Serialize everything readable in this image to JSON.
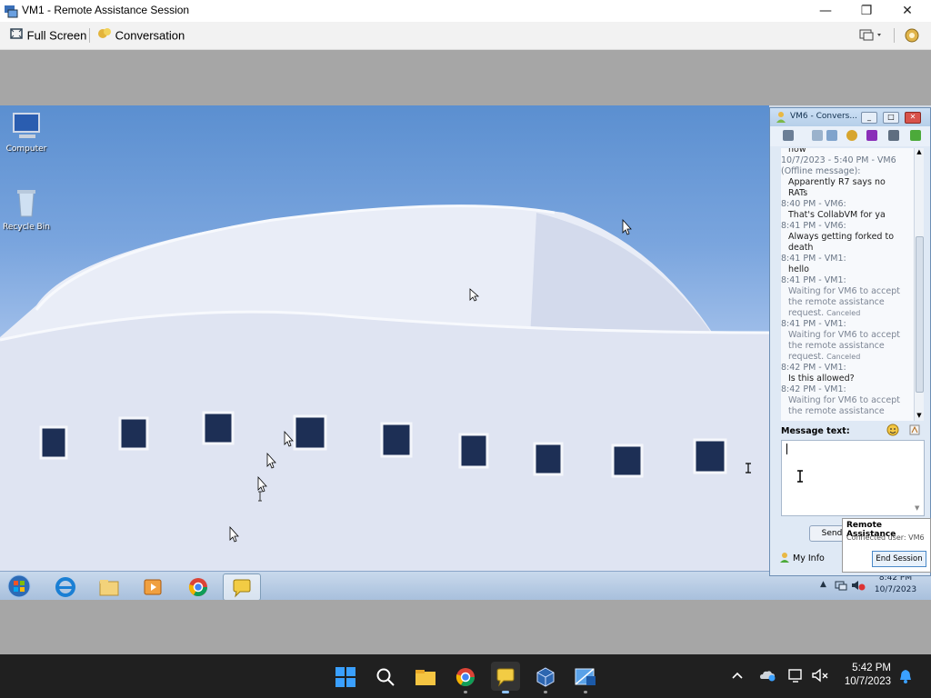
{
  "window": {
    "title": "VM1 - Remote Assistance Session",
    "minimize": "—",
    "restore": "❐",
    "close": "✕"
  },
  "toolbar": {
    "full_screen": "Full Screen",
    "conversation": "Conversation"
  },
  "desktop": {
    "icons": [
      {
        "label": "Computer"
      },
      {
        "label": "Recycle Bin"
      }
    ],
    "taskbar_clock": {
      "time": "8:42 PM",
      "date": "10/7/2023"
    }
  },
  "conversation": {
    "title": "VM6 - Convers...",
    "messages": [
      {
        "meta": "",
        "body": "now"
      },
      {
        "meta": "10/7/2023 - 5:40 PM - VM6",
        "body": ""
      },
      {
        "meta": "(Offline message):",
        "body": ""
      },
      {
        "meta": "",
        "body": "Apparently R7 says no"
      },
      {
        "meta": "",
        "body": "RATs"
      },
      {
        "meta": "8:40 PM - VM6:",
        "body": ""
      },
      {
        "meta": "",
        "body": "That's CollabVM for ya"
      },
      {
        "meta": "8:41 PM - VM6:",
        "body": ""
      },
      {
        "meta": "",
        "body": "Always getting forked to"
      },
      {
        "meta": "",
        "body": "death"
      },
      {
        "meta": "8:41 PM - VM1:",
        "body": ""
      },
      {
        "meta": "",
        "body": "hello"
      },
      {
        "meta": "8:41 PM - VM1:",
        "body": ""
      },
      {
        "meta": "",
        "grey": "Waiting for VM6 to accept"
      },
      {
        "meta": "",
        "grey": "the remote assistance"
      },
      {
        "meta": "",
        "grey": "request.",
        "small": "Canceled"
      },
      {
        "meta": "8:41 PM - VM1:",
        "body": ""
      },
      {
        "meta": "",
        "grey": "Waiting for VM6 to accept"
      },
      {
        "meta": "",
        "grey": "the remote assistance"
      },
      {
        "meta": "",
        "grey": "request.",
        "small": "Canceled"
      },
      {
        "meta": "8:42 PM - VM1:",
        "body": ""
      },
      {
        "meta": "",
        "body": "Is this allowed?"
      },
      {
        "meta": "8:42 PM - VM1:",
        "body": ""
      },
      {
        "meta": "",
        "grey": "Waiting for VM6 to accept"
      },
      {
        "meta": "",
        "grey": "the remote assistance"
      }
    ],
    "message_text_label": "Message text:",
    "send": "Send",
    "my_info": "My Info"
  },
  "popup": {
    "title": "Remote Assistance",
    "subtitle": "Connected user: VM6",
    "end_session": "End Session"
  },
  "host_taskbar": {
    "clock_time": "5:42 PM",
    "clock_date": "10/7/2023"
  }
}
